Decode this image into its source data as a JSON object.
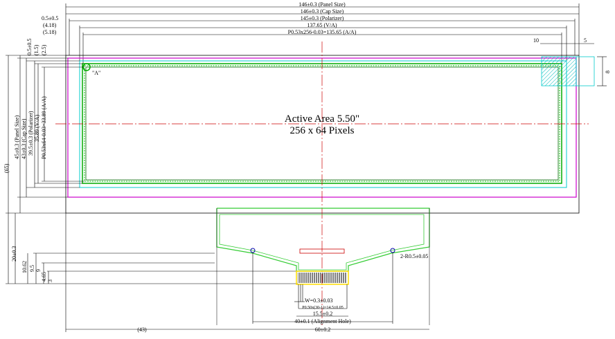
{
  "top_dims": {
    "panel_size": "146±0.3 (Panel Size)",
    "cap_size": "146±0.3 (Cap Size)",
    "polarizer": "145±0.3 (Polarizer)",
    "va": "137.65 (V/A)",
    "aa": "P0.53x256-0.03=135.65 (A/A)",
    "side_a": "0.5±0.5",
    "side_b": "(4.18)",
    "side_c": "(5.18)",
    "corner_10": "10",
    "corner_5": "5",
    "corner_8": "8"
  },
  "left_dims": {
    "top_a": "0.5±0.5",
    "top_b": "(1.5)",
    "top_c": "(2.5)",
    "overall": "(65)",
    "panel_size": "45±0.3 (Panel Size)",
    "cap_size": "43±0.3 (Cap Size)",
    "polarizer": "39.5±0.3 (Polarizer)",
    "va": "35.89 (V/A)",
    "aa": "P0.53x64-0.03=33.89 (A/A)",
    "fpc_20": "20±0.3",
    "fpc_1062": "10.62",
    "fpc_95": "9.5",
    "fpc_9": "9",
    "fpc_465": "4.65",
    "fpc_3": "3"
  },
  "active_area": {
    "title": "Active Area 5.50\"",
    "pixels": "256 x 64 Pixels"
  },
  "marker_a": "\"A\"",
  "fpc": {
    "hole_label": "2-R0.5±0.05",
    "w_label": "W=0.3±0.03",
    "pitch_label": "P0.50x(30-1)=14.5±0.05",
    "width_155": "15.5±0.2",
    "align_40": "40±0.1 (Alignment Hole)",
    "width_60": "60±0.2",
    "offset_43": "(43)"
  },
  "colors": {
    "panel": "#000000",
    "cap": "#cc00cc",
    "polarizer": "#00cccc",
    "va": "#00aa00",
    "aa": "#006600",
    "center": "#cc0000",
    "fpc": "#33cc33",
    "fpc_yellow": "#ffdd00"
  }
}
